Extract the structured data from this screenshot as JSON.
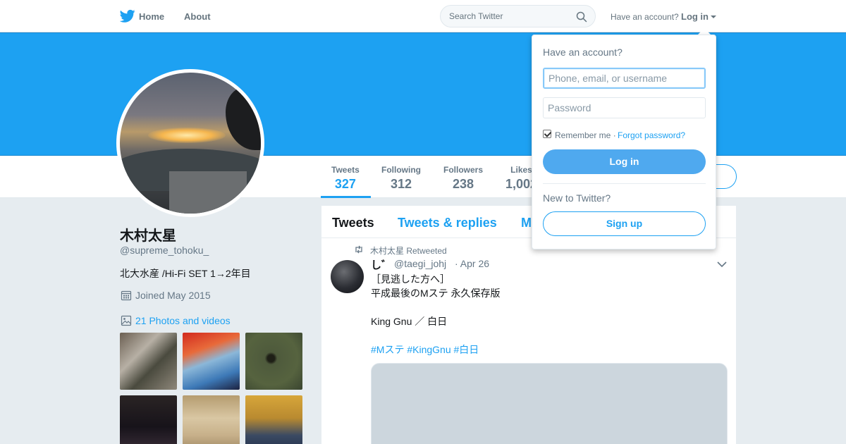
{
  "nav": {
    "home_label": "Home",
    "about_label": "About",
    "search_placeholder": "Search Twitter",
    "have_account_label": "Have an account?",
    "login_label": "Log in"
  },
  "stats": {
    "tweets_label": "Tweets",
    "tweets_value": "327",
    "following_label": "Following",
    "following_value": "312",
    "followers_label": "Followers",
    "followers_value": "238",
    "likes_label": "Likes",
    "likes_value": "1,002"
  },
  "profile": {
    "name": "木村太星",
    "handle": "@supreme_tohoku_",
    "bio": "北大水産 /Hi-Fi SET 1→2年目",
    "joined": "Joined May 2015",
    "photos_link": "21 Photos and videos"
  },
  "timeline": {
    "tabs": [
      "Tweets",
      "Tweets & replies",
      "M"
    ],
    "tweet": {
      "retweeted_by": "木村太星 Retweeted",
      "author": "し゛",
      "handle": "@taegi_johj",
      "date": "· Apr 26",
      "line1": "［見逃した方へ］",
      "line2": "平成最後のMステ 永久保存版",
      "line3": "King Gnu ／ 白日",
      "hashtags": "#Mステ #KingGnu #白日"
    }
  },
  "login_dropdown": {
    "title": "Have an account?",
    "username_placeholder": "Phone, email, or username",
    "password_placeholder": "Password",
    "remember_label": "Remember me ·",
    "forgot_label": "Forgot password?",
    "remember_checked": true,
    "login_button": "Log in",
    "new_label": "New to Twitter?",
    "signup_button": "Sign up"
  },
  "colors": {
    "accent": "#1da1f2",
    "banner": "#1da1f2",
    "background": "#e6ecf0"
  },
  "icons": {
    "logo": "twitter-bird-icon",
    "search": "search-icon",
    "caret": "caret-down-icon",
    "calendar": "calendar-icon",
    "photos": "photo-icon",
    "retweet": "retweet-icon",
    "chevron": "chevron-down-icon"
  }
}
